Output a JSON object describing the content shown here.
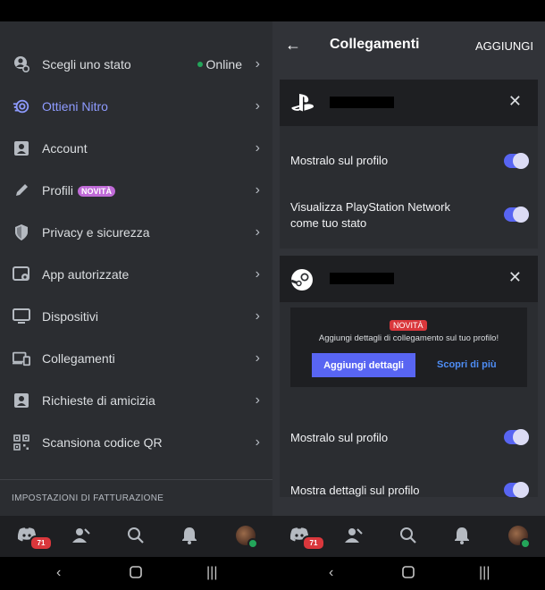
{
  "left_menu": {
    "items": [
      {
        "label": "Scegli uno stato",
        "status": "Online"
      },
      {
        "label": "Ottieni Nitro"
      },
      {
        "label": "Account"
      },
      {
        "label": "Profili",
        "badge": "NOVITÀ"
      },
      {
        "label": "Privacy e sicurezza"
      },
      {
        "label": "App autorizzate"
      },
      {
        "label": "Dispositivi"
      },
      {
        "label": "Collegamenti"
      },
      {
        "label": "Richieste di amicizia"
      },
      {
        "label": "Scansiona codice QR"
      }
    ],
    "section_header": "IMPOSTAZIONI DI FATTURAZIONE"
  },
  "connections": {
    "title": "Collegamenti",
    "add_label": "AGGIUNGI",
    "playstation": {
      "row1": "Mostralo sul profilo",
      "row2": "Visualizza PlayStation Network come tuo stato",
      "toggles": [
        true,
        true
      ]
    },
    "steam": {
      "promo_badge": "NOVITÀ",
      "promo_text": "Aggiungi dettagli di collegamento sul tuo profilo!",
      "promo_button": "Aggiungi dettagli",
      "promo_link": "Scopri di più",
      "row1": "Mostralo sul profilo",
      "row2": "Mostra dettagli sul profilo",
      "toggles": [
        true,
        true
      ]
    }
  },
  "bottom_nav": {
    "mention_count": "71"
  },
  "colors": {
    "accent": "#5865f2",
    "nitro": "#8e9bff",
    "online": "#23a55a",
    "badge_red": "#da373c"
  }
}
